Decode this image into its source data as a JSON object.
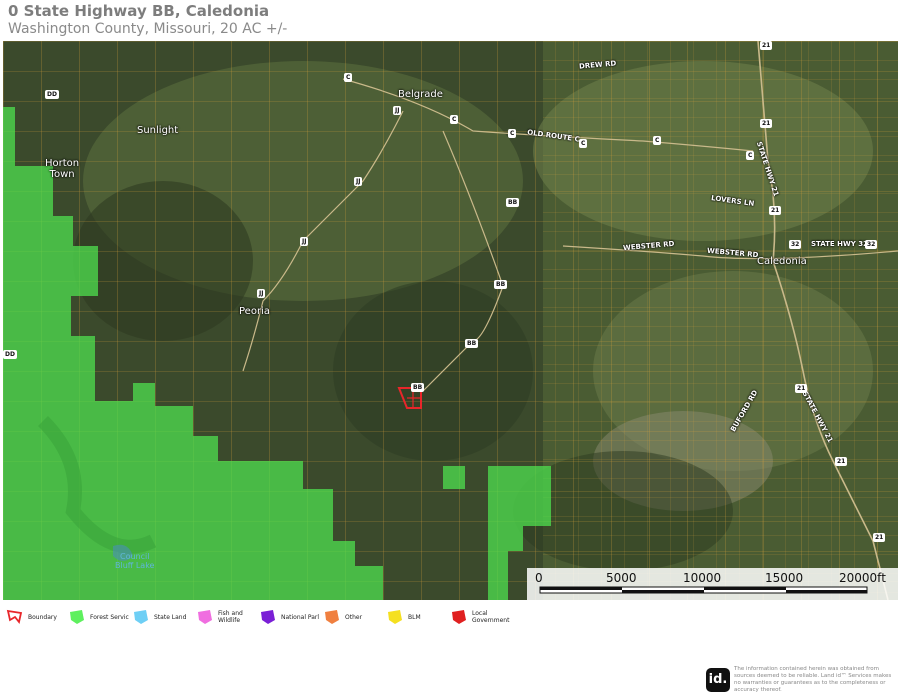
{
  "header": {
    "title": "0 State Highway BB, Caledonia",
    "subtitle": "Washington County, Missouri, 20 AC +/-"
  },
  "map": {
    "places": [
      {
        "name": "Belgrade"
      },
      {
        "name": "Sunlight"
      },
      {
        "name": "Horton\nTown"
      },
      {
        "name": "Peoria"
      },
      {
        "name": "Caledonia"
      }
    ],
    "roads": {
      "drew_rd": "DREW RD",
      "old_route_c": "OLD ROUTE C",
      "lovers_ln": "LOVERS LN",
      "webster_rd_1": "WEBSTER RD",
      "webster_rd_2": "WEBSTER RD",
      "state_hwy_32": "STATE HWY 32",
      "state_hwy_21_north": "STATE HWY 21",
      "state_hwy_21_south": "STATE HWY 21",
      "buford_rd": "BUFORD RD"
    },
    "shields": {
      "dd": "DD",
      "c1": "C",
      "c2": "C",
      "c3": "C",
      "c4": "C",
      "c5": "C",
      "c6": "C",
      "jj1": "JJ",
      "jj2": "JJ",
      "jj3": "JJ",
      "jj4": "JJ",
      "bb1": "BB",
      "bb2": "BB",
      "bb3": "BB",
      "bb4": "BB",
      "h21a": "21",
      "h21b": "21",
      "h21c": "21",
      "h21d": "21",
      "h21e": "21",
      "h21f": "21",
      "h32a": "32",
      "h32b": "32",
      "edge_dd": "DD"
    },
    "lake": "Council\nBluff Lake",
    "colors": {
      "forest_service": "#4fe04f",
      "parcel_lines": "#d9a13a",
      "boundary": "#e8262a"
    }
  },
  "scale_bar": {
    "labels": [
      "0",
      "5000",
      "10000",
      "15000",
      "20000ft"
    ]
  },
  "legend": [
    {
      "label": "Boundary",
      "color": "#e8262a",
      "icon": "boundary-outline-icon"
    },
    {
      "label": "Forest Servic",
      "color": "#5ef05e",
      "icon": "forest-service-icon"
    },
    {
      "label": "State Land",
      "color": "#6ecff5",
      "icon": "state-land-icon"
    },
    {
      "label": "Fish and Wildlife",
      "color": "#f06ee0",
      "icon": "fish-wildlife-icon"
    },
    {
      "label": "National Parl",
      "color": "#7a1fd6",
      "icon": "national-park-icon"
    },
    {
      "label": "Other",
      "color": "#f08040",
      "icon": "other-land-icon"
    },
    {
      "label": "BLM",
      "color": "#f5e020",
      "icon": "blm-icon"
    },
    {
      "label": "Local Government",
      "color": "#e02020",
      "icon": "local-government-icon"
    }
  ],
  "footer": {
    "logo": "id.",
    "disclaimer": "The information contained herein was obtained from sources deemed to be reliable. Land id™ Services makes no warranties or guarantees as to the completeness or accuracy thereof."
  }
}
